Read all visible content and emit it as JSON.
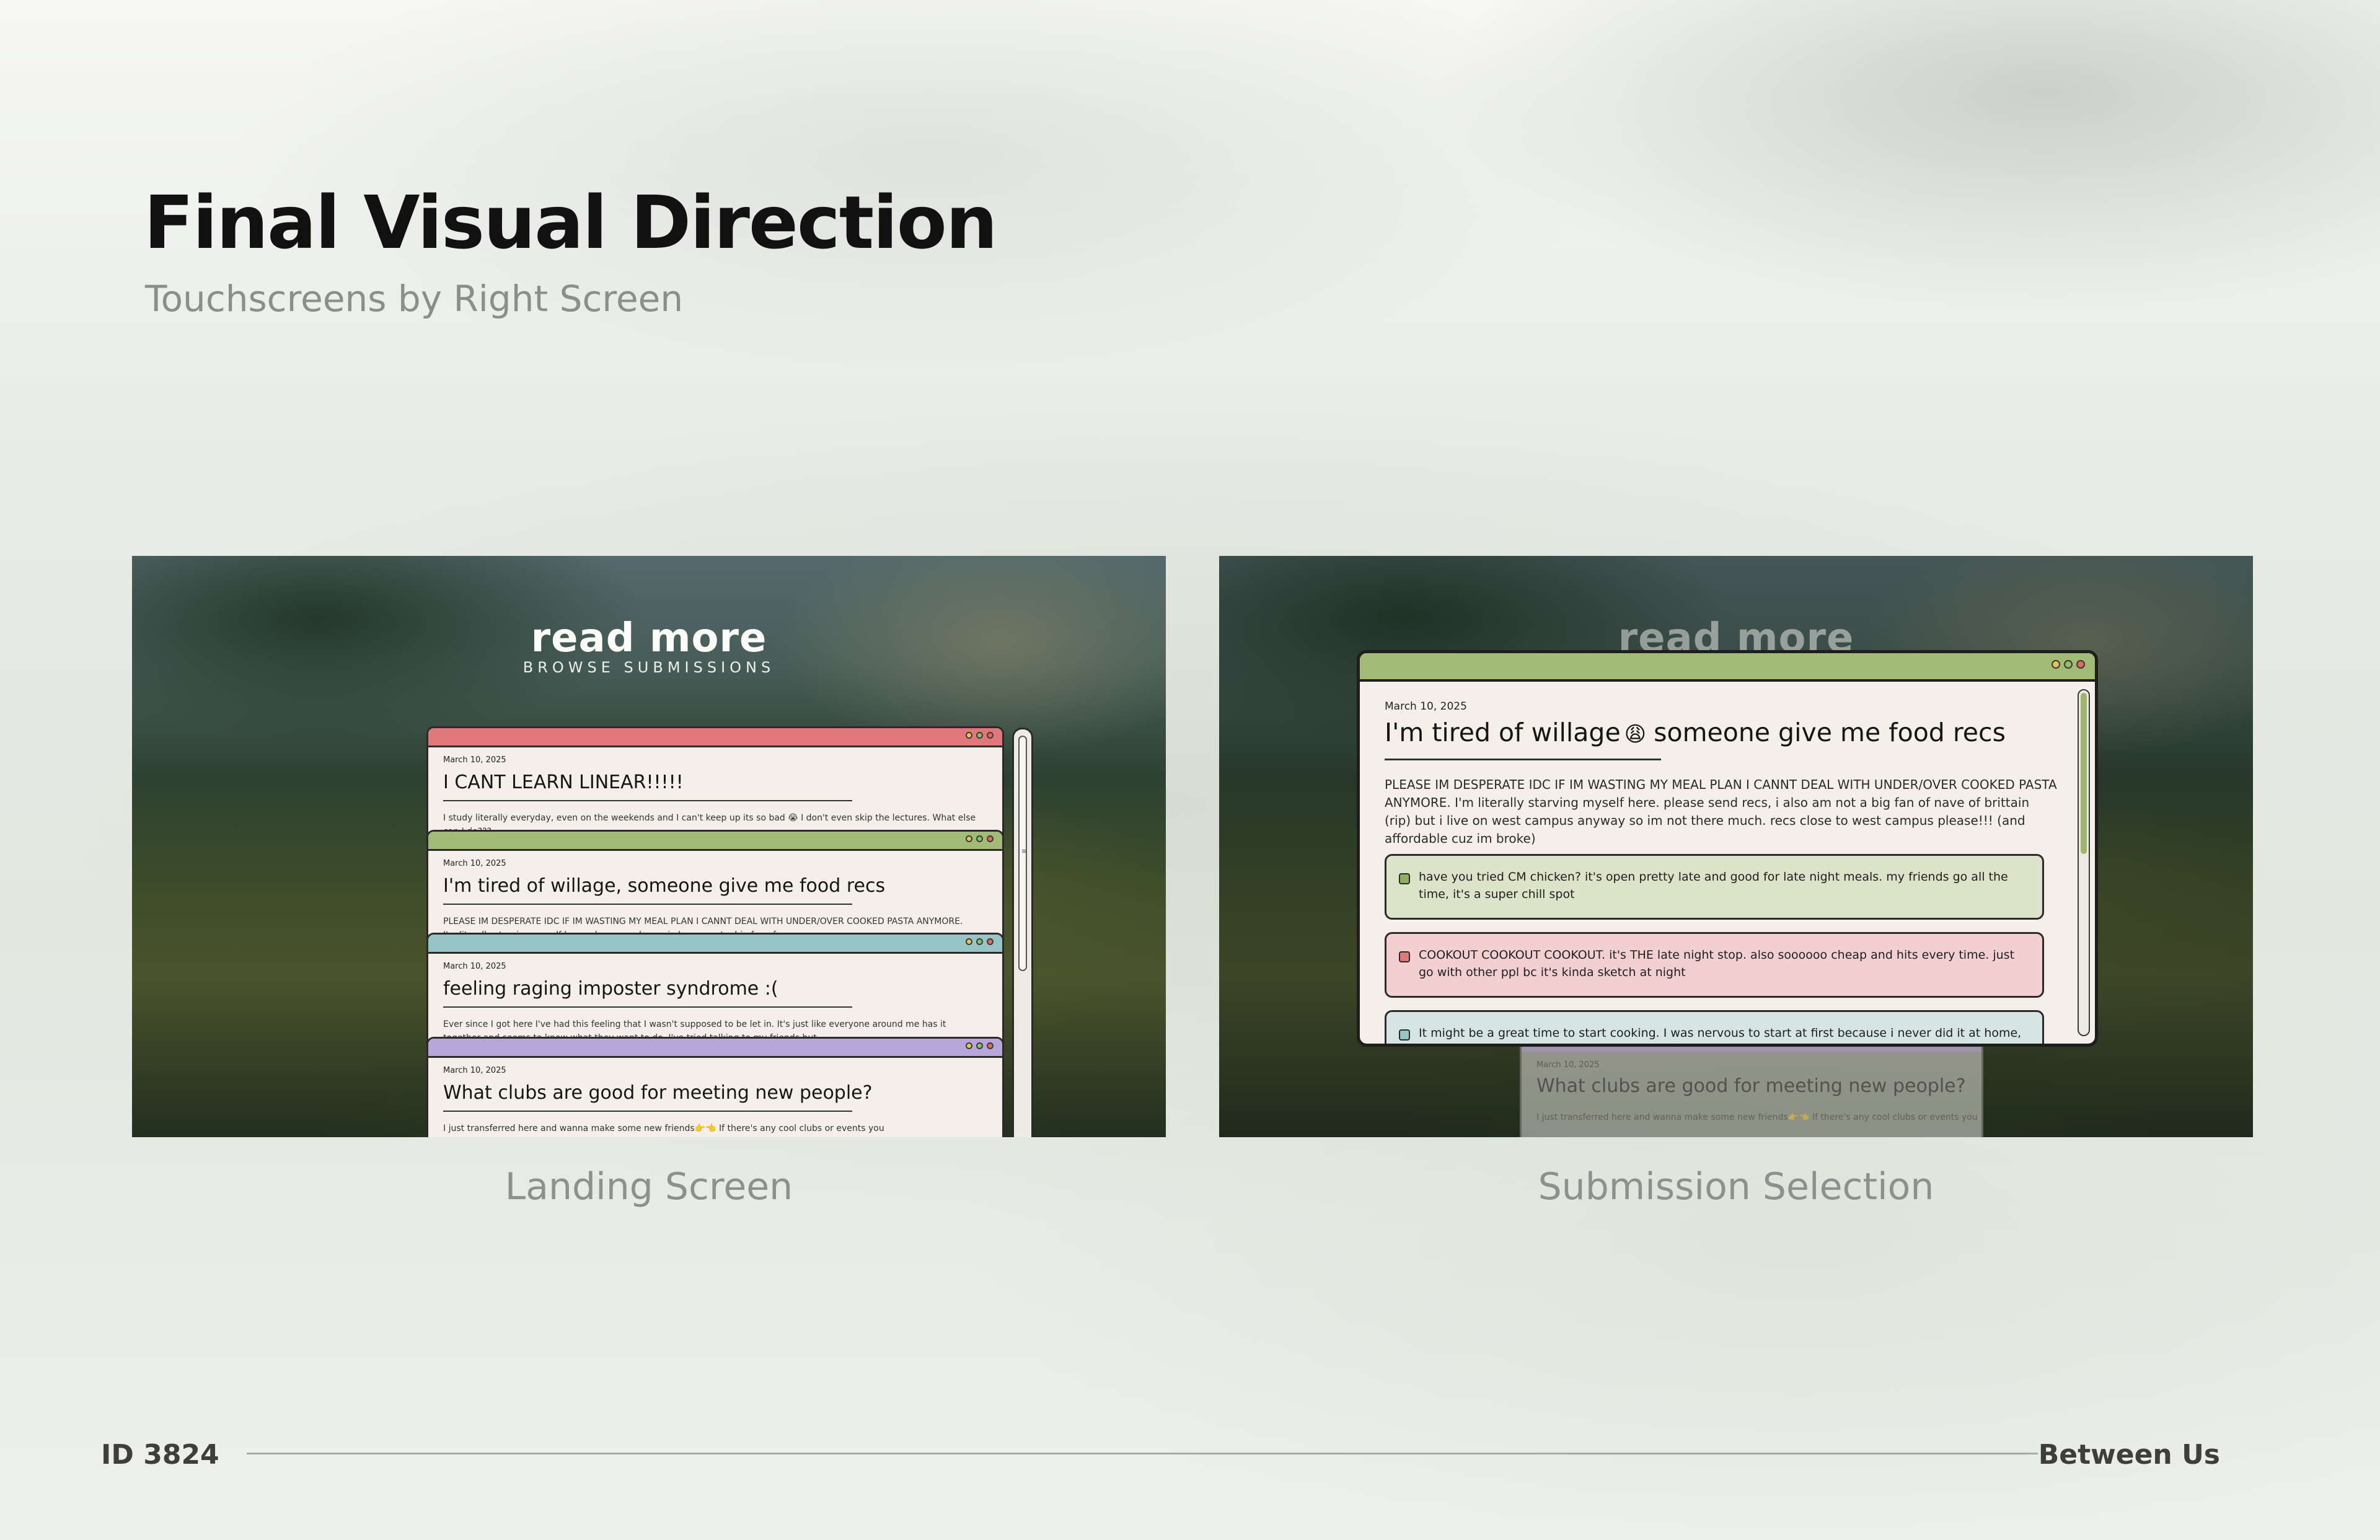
{
  "header": {
    "title": "Final Visual Direction",
    "subtitle": "Touchscreens by Right Screen"
  },
  "landing": {
    "caption": "Landing Screen",
    "hero_title": "read more",
    "hero_subtitle": "BROWSE SUBMISSIONS",
    "cards": [
      {
        "date": "March 10, 2025",
        "title": "I CANT LEARN LINEAR!!!!!",
        "body": "I study literally everyday, even on the weekends and I can't keep up its so bad 😭 I don't even skip the lectures. What else can I do???",
        "accent": "#e0777a"
      },
      {
        "date": "March 10, 2025",
        "title": "I'm tired of willage, someone give me food recs",
        "body": "PLEASE IM DESPERATE IDC IF IM WASTING MY MEAL PLAN I CANNT DEAL WITH UNDER/OVER COOKED PASTA ANYMORE. I'm literally starving myself here. please send recs, i also am not a big fan of",
        "accent": "#a3bb79"
      },
      {
        "date": "March 10, 2025",
        "title": "feeling raging imposter syndrome :(",
        "body": "Ever since I got here I've had this feeling that I wasn't supposed to be let in. It's just like everyone around me has it together and seems to know what they want to do. I've tried talking to my friends but",
        "accent": "#97c4c4"
      },
      {
        "date": "March 10, 2025",
        "title": "What clubs are good for meeting new people?",
        "body": "I just transferred here and wanna make some new friends👉👈 If there's any cool clubs or events you",
        "accent": "#b6a6d9"
      }
    ]
  },
  "submission": {
    "caption": "Submission Selection",
    "hero_title": "read more",
    "modal": {
      "date": "March 10, 2025",
      "title_part1": "I'm tired of willage",
      "emoji": "😩",
      "title_part2": "someone give me food recs",
      "body": "PLEASE IM DESPERATE IDC IF IM WASTING MY MEAL PLAN I CANNT DEAL WITH UNDER/OVER COOKED PASTA ANYMORE. I'm literally starving myself here. please send recs, i also am not a big fan of nave of brittain (rip) but i live on west campus anyway so im not there much. recs close to west campus please!!! (and affordable cuz im broke)",
      "accent": "#a3bb79",
      "replies": [
        {
          "text": "have you tried CM chicken? it's open pretty late and good for late night meals. my friends go all the time, it's a super chill spot",
          "bg": "#dde3c8",
          "box": "#8fae62"
        },
        {
          "text": "COOKOUT COOKOUT COOKOUT. it's THE late night stop. also soooooo cheap and hits every time. just go with other ppl bc it's kinda sketch at night",
          "bg": "#f2cfd0",
          "box": "#e0777a"
        },
        {
          "text": "It might be a great time to start cooking. I was nervous to start at first because i never did it at home, but if you",
          "bg": "#d6e4e4",
          "box": "#97c4c4"
        }
      ]
    },
    "behind_card": {
      "date": "March 10, 2025",
      "title": "What clubs are good for meeting new people?",
      "body": "I just transferred here and wanna make some new friends👉👈 If there's any cool clubs or events you"
    }
  },
  "footer": {
    "id_label": "ID 3824",
    "brand": "Between Us"
  },
  "colors": {
    "dot_red": "#e06a5f",
    "dot_yellow": "#e8c25a",
    "dot_green": "#8fbf6a"
  }
}
